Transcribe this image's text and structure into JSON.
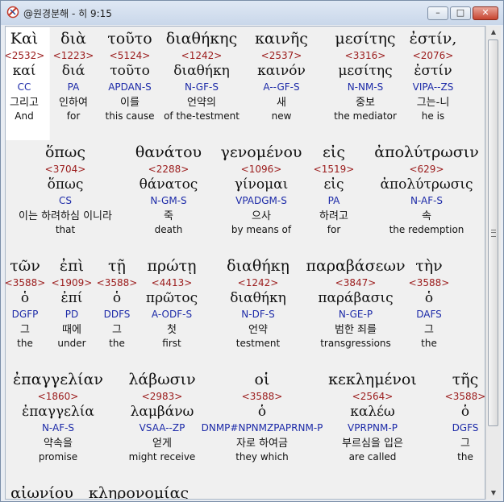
{
  "window": {
    "title": "@원경분해 - 히 9:15",
    "controls": {
      "minimize": "–",
      "maximize": "□",
      "close": "✕"
    }
  },
  "rows": [
    [
      {
        "gk": "Καὶ",
        "num": "<2532>",
        "lex": "καί",
        "parse": "CC",
        "ko": "그리고",
        "en": "And",
        "selected": true
      },
      {
        "gk": "διὰ",
        "num": "<1223>",
        "lex": "διά",
        "parse": "PA",
        "ko": "인하여",
        "en": "for"
      },
      {
        "gk": "τοῦτο",
        "num": "<5124>",
        "lex": "τοῦτο",
        "parse": "APDAN-S",
        "ko": "이를",
        "en": "this cause"
      },
      {
        "gk": "διαθήκης",
        "num": "<1242>",
        "lex": "διαθήκη",
        "parse": "N-GF-S",
        "ko": "언약의",
        "en": "of the-testment"
      },
      {
        "gk": "καινῆς",
        "num": "<2537>",
        "lex": "καινόν",
        "parse": "A--GF-S",
        "ko": "새",
        "en": "new"
      },
      {
        "gk": "μεσίτης",
        "num": "<3316>",
        "lex": "μεσίτης",
        "parse": "N-NM-S",
        "ko": "중보",
        "en": "the mediator"
      },
      {
        "gk": "ἐστίν,",
        "num": "<2076>",
        "lex": "ἐστίν",
        "parse": "VIPA--ZS",
        "ko": "그는-니",
        "en": "he is"
      }
    ],
    [
      {
        "gk": "ὅπως",
        "num": "<3704>",
        "lex": "ὅπως",
        "parse": "CS",
        "ko": "이는 하려하심 이니라",
        "en": "that"
      },
      {
        "gk": "θανάτου",
        "num": "<2288>",
        "lex": "θάνατος",
        "parse": "N-GM-S",
        "ko": "죽",
        "en": "death"
      },
      {
        "gk": "γενομένου",
        "num": "<1096>",
        "lex": "γίνομαι",
        "parse": "VPADGM-S",
        "ko": "으사",
        "en": "by means of"
      },
      {
        "gk": "εἰς",
        "num": "<1519>",
        "lex": "εἰς",
        "parse": "PA",
        "ko": "하려고",
        "en": "for"
      },
      {
        "gk": "ἀπολύτρωσιν",
        "num": "<629>",
        "lex": "ἀπολύτρωσις",
        "parse": "N-AF-S",
        "ko": "속",
        "en": "the redemption"
      }
    ],
    [
      {
        "gk": "τῶν",
        "num": "<3588>",
        "lex": "ὁ",
        "parse": "DGFP",
        "ko": "그",
        "en": "the"
      },
      {
        "gk": "ἐπὶ",
        "num": "<1909>",
        "lex": "ἐπί",
        "parse": "PD",
        "ko": "때에",
        "en": "under"
      },
      {
        "gk": "τῇ",
        "num": "<3588>",
        "lex": "ὁ",
        "parse": "DDFS",
        "ko": "그",
        "en": "the"
      },
      {
        "gk": "πρώτῃ",
        "num": "<4413>",
        "lex": "πρῶτος",
        "parse": "A-ODF-S",
        "ko": "첫",
        "en": "first"
      },
      {
        "gk": "διαθήκῃ",
        "num": "<1242>",
        "lex": "διαθήκη",
        "parse": "N-DF-S",
        "ko": "언약",
        "en": "testment"
      },
      {
        "gk": "παραβάσεων",
        "num": "<3847>",
        "lex": "παράβασις",
        "parse": "N-GE-P",
        "ko": "범한 죄를",
        "en": "transgressions"
      },
      {
        "gk": "τὴν",
        "num": "<3588>",
        "lex": "ὁ",
        "parse": "DAFS",
        "ko": "그",
        "en": "the"
      }
    ],
    [
      {
        "gk": "ἐπαγγελίαν",
        "num": "<1860>",
        "lex": "ἐπαγγελία",
        "parse": "N-AF-S",
        "ko": "약속을",
        "en": "promise"
      },
      {
        "gk": "λάβωσιν",
        "num": "<2983>",
        "lex": "λαμβάνω",
        "parse": "VSAA--ZP",
        "ko": "얻게",
        "en": "might receive"
      },
      {
        "gk": "οἱ",
        "num": "<3588>",
        "lex": "ὁ",
        "parse": "DNMP#NPNMZPAPRNM-P",
        "ko": "자로 하여금",
        "en": "they which"
      },
      {
        "gk": "κεκλημένοι",
        "num": "<2564>",
        "lex": "καλέω",
        "parse": "VPRPNM-P",
        "ko": "부르심을 입은",
        "en": "are called"
      },
      {
        "gk": "τῆς",
        "num": "<3588>",
        "lex": "ὁ",
        "parse": "DGFS",
        "ko": "그",
        "en": "the"
      }
    ],
    [
      {
        "gk": "αἰωνίου",
        "num": "",
        "lex": "",
        "parse": "",
        "ko": "",
        "en": ""
      },
      {
        "gk": "κληρονομίας",
        "num": "",
        "lex": "",
        "parse": "",
        "ko": "",
        "en": ""
      }
    ]
  ]
}
